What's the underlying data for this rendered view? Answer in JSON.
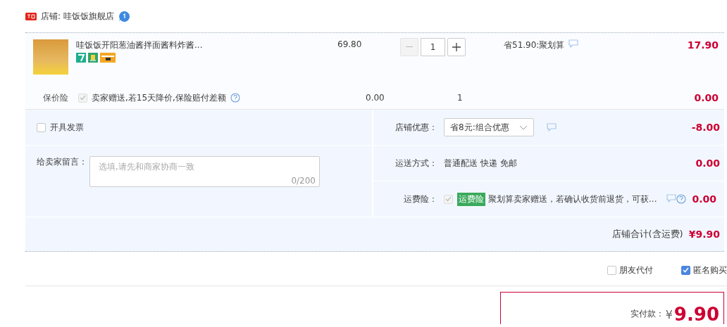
{
  "shop": {
    "label": "店铺: 哇饭饭旗舰店"
  },
  "item": {
    "title": "哇饭饭开阳葱油酱拌面酱料炸酱...",
    "price": "69.80",
    "quantity": "1",
    "discount": "省51.90:聚划算",
    "total": "17.90"
  },
  "price_protection": {
    "label": "保价险",
    "checked": true,
    "disabled": true,
    "text": "卖家赠送,若15天降价,保险赔付差额",
    "price": "0.00",
    "quantity": "1",
    "total": "0.00"
  },
  "invoice": {
    "label": "开具发票",
    "checked": false
  },
  "message": {
    "label": "给卖家留言：",
    "placeholder": "选填,请先和商家协商一致",
    "counter": "0/200"
  },
  "shop_discount": {
    "label": "店铺优惠：",
    "value": "省8元:组合优惠",
    "amount": "-8.00"
  },
  "shipping": {
    "label": "运送方式：",
    "value": "普通配送 快递 免邮",
    "amount": "0.00"
  },
  "freight_insurance": {
    "label": "运费险：",
    "checked": true,
    "disabled": true,
    "badge": "运费险",
    "text": "聚划算卖家赠送，若确认收货前退货，可获...",
    "amount": "0.00"
  },
  "shop_total": {
    "label": "店铺合计(含运费)",
    "amount": "¥9.90"
  },
  "options": [
    {
      "label": "朋友代付",
      "checked": false
    },
    {
      "label": "匿名购买",
      "checked": true
    }
  ],
  "payment": {
    "label": "实付款：",
    "currency": "¥",
    "amount": "9.90"
  }
}
